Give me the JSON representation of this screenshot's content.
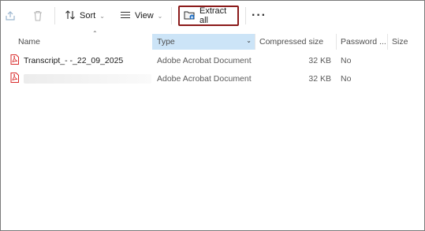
{
  "toolbar": {
    "share_icon": "share-icon",
    "delete_icon": "trash-icon",
    "sort_label": "Sort",
    "view_label": "View",
    "extract_label": "Extract all",
    "more_label": "···"
  },
  "columns": {
    "name": "Name",
    "type": "Type",
    "compressed_size": "Compressed size",
    "password": "Password ...",
    "size": "Size"
  },
  "files": [
    {
      "name": "Transcript_- -_22_09_2025",
      "type": "Adobe Acrobat Document",
      "compressed_size": "32 KB",
      "password": "No",
      "icon": "pdf-file-icon"
    },
    {
      "name": "",
      "type": "Adobe Acrobat Document",
      "compressed_size": "32 KB",
      "password": "No",
      "icon": "pdf-file-icon"
    }
  ],
  "colors": {
    "highlight_border": "#8b1a1a",
    "sorted_column_bg": "#cce4f7",
    "pdf_red": "#d92b2b"
  }
}
